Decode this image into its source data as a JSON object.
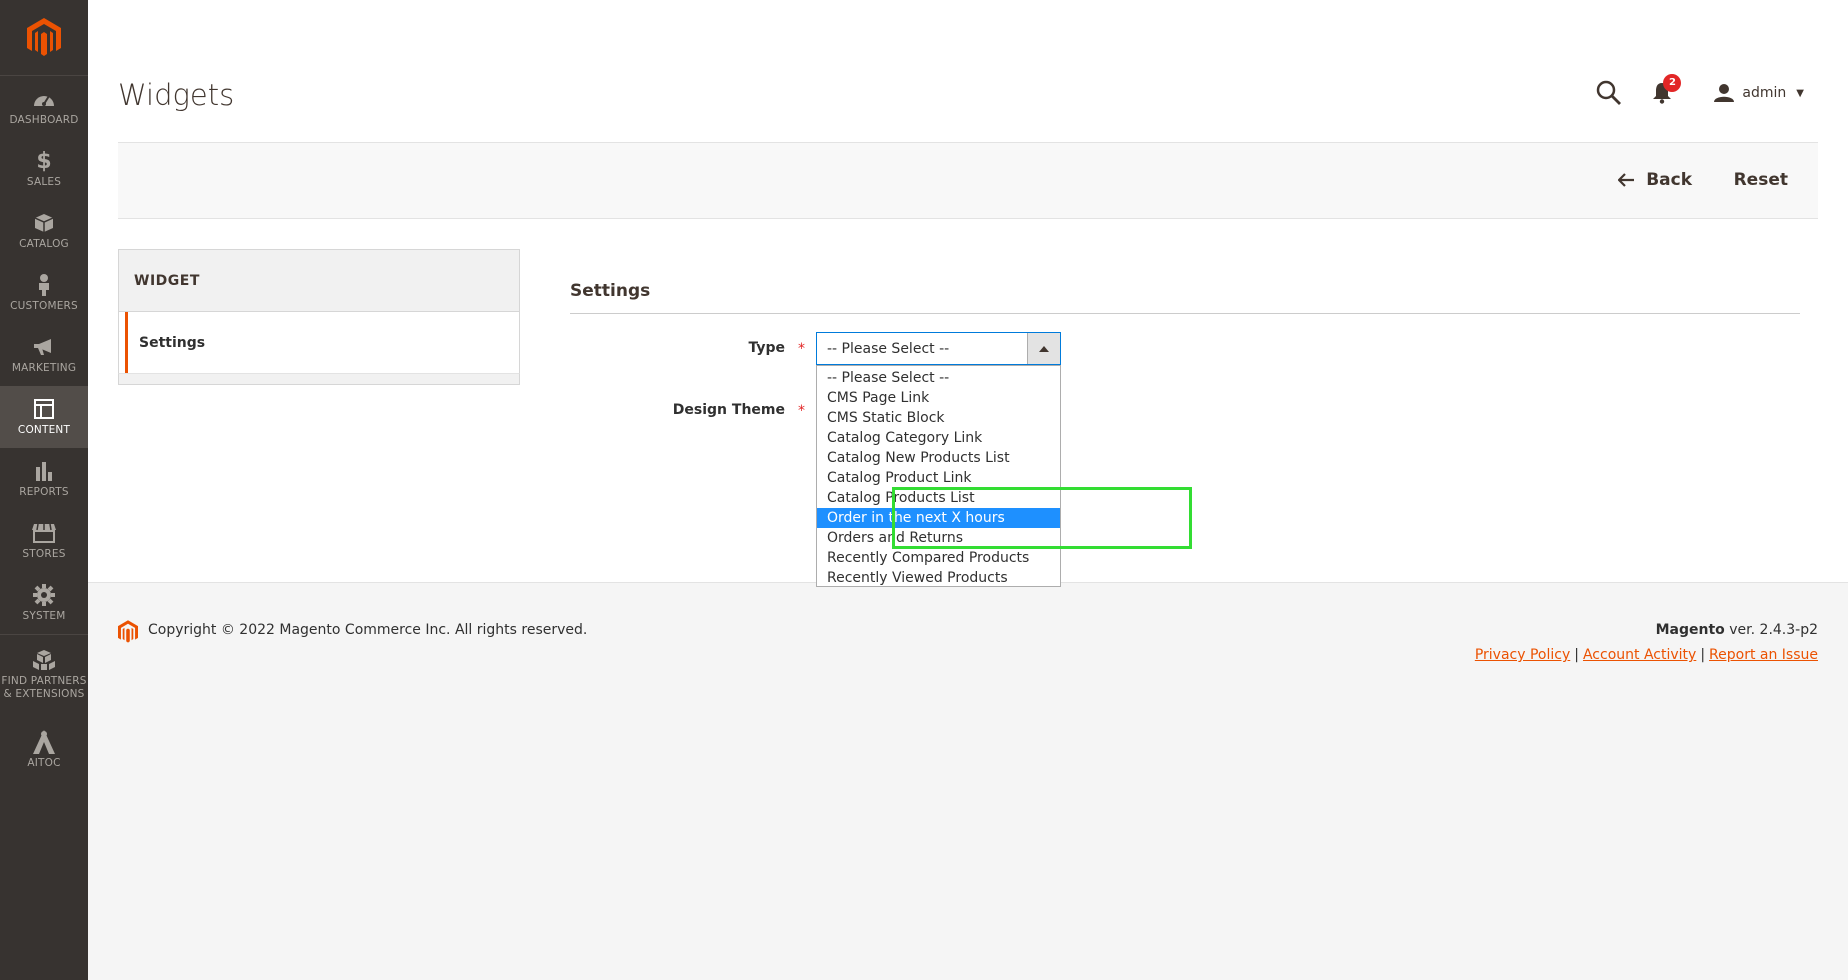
{
  "sidebar": {
    "items": [
      {
        "label": "DASHBOARD",
        "icon": "dashboard-icon"
      },
      {
        "label": "SALES",
        "icon": "dollar-icon"
      },
      {
        "label": "CATALOG",
        "icon": "box-icon"
      },
      {
        "label": "CUSTOMERS",
        "icon": "person-icon"
      },
      {
        "label": "MARKETING",
        "icon": "megaphone-icon"
      },
      {
        "label": "CONTENT",
        "icon": "layout-icon"
      },
      {
        "label": "REPORTS",
        "icon": "bar-chart-icon"
      },
      {
        "label": "STORES",
        "icon": "store-icon"
      },
      {
        "label": "SYSTEM",
        "icon": "gear-icon"
      },
      {
        "label": "FIND PARTNERS & EXTENSIONS",
        "icon": "cubes-icon"
      },
      {
        "label": "AITOC",
        "icon": "aitoc-icon"
      }
    ],
    "active": "CONTENT"
  },
  "header": {
    "title": "Widgets",
    "notifications_count": "2",
    "user": "admin"
  },
  "actions": {
    "back": "Back",
    "reset": "Reset"
  },
  "tabs": {
    "title": "WIDGET",
    "items": [
      "Settings"
    ]
  },
  "settings": {
    "title": "Settings",
    "type_label": "Type",
    "design_theme_label": "Design Theme",
    "type_value": "-- Please Select --",
    "options": [
      "-- Please Select --",
      "CMS Page Link",
      "CMS Static Block",
      "Catalog Category Link",
      "Catalog New Products List",
      "Catalog Product Link",
      "Catalog Products List",
      "Order in the next X hours",
      "Orders and Returns",
      "Recently Compared Products",
      "Recently Viewed Products"
    ],
    "highlighted_option": "Order in the next X hours"
  },
  "footer": {
    "copyright": "Copyright © 2022 Magento Commerce Inc. All rights reserved.",
    "brand": "Magento",
    "version": " ver. 2.4.3-p2",
    "links": [
      "Privacy Policy",
      "Account Activity",
      "Report an Issue"
    ]
  },
  "colors": {
    "accent": "#eb5202",
    "sidebar_bg": "#373330",
    "selected_option": "#1e90ff",
    "highlight_box": "#33dd33"
  }
}
